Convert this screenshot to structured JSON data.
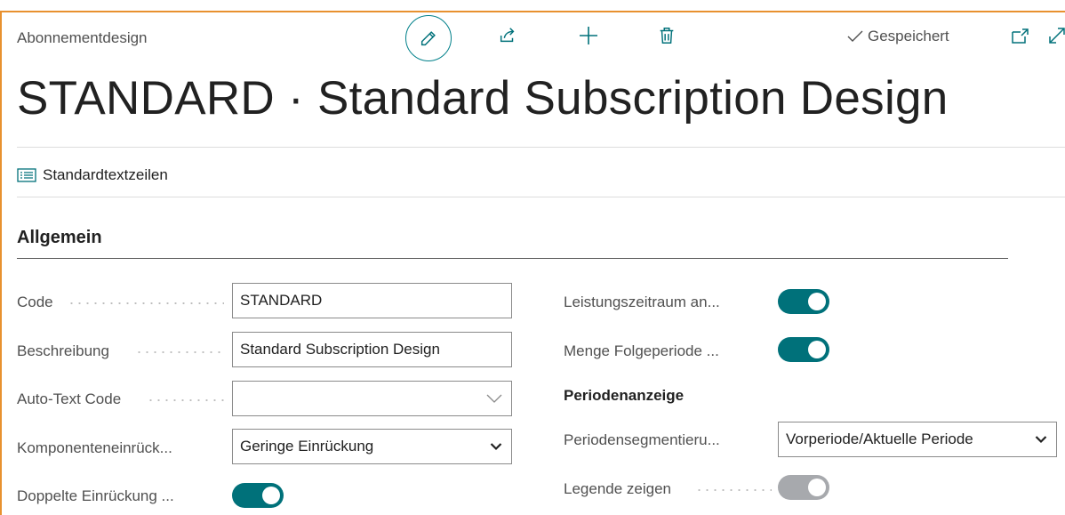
{
  "header": {
    "breadcrumb": "Abonnementdesign",
    "saved_label": "Gespeichert",
    "title": "STANDARD · Standard Subscription Design"
  },
  "toolbar": {
    "icons": [
      "pencil-icon",
      "share-icon",
      "plus-icon",
      "trash-icon",
      "open-new-window-icon",
      "expand-icon"
    ]
  },
  "actions": {
    "standard_text_lines": "Standardtextzeilen"
  },
  "section": {
    "title": "Allgemein"
  },
  "fields": {
    "code": {
      "label": "Code",
      "value": "STANDARD"
    },
    "description": {
      "label": "Beschreibung",
      "value": "Standard Subscription Design"
    },
    "auto_text_code": {
      "label": "Auto-Text Code",
      "value": ""
    },
    "component_indent": {
      "label": "Komponenteneinrück...",
      "value": "Geringe Einrückung"
    },
    "double_indent": {
      "label": "Doppelte Einrückung ...",
      "value": true
    },
    "service_period": {
      "label": "Leistungszeitraum an...",
      "value": true
    },
    "quantity_next_period": {
      "label": "Menge Folgeperiode ...",
      "value": true
    },
    "period_display_heading": "Periodenanzeige",
    "period_segmentation": {
      "label": "Periodensegmentieru...",
      "value": "Vorperiode/Aktuelle Periode"
    },
    "show_legend": {
      "label": "Legende zeigen",
      "value": false
    }
  },
  "colors": {
    "accent": "#00717a",
    "frame": "#e8912f",
    "toggle_off": "#a7a9ad"
  }
}
